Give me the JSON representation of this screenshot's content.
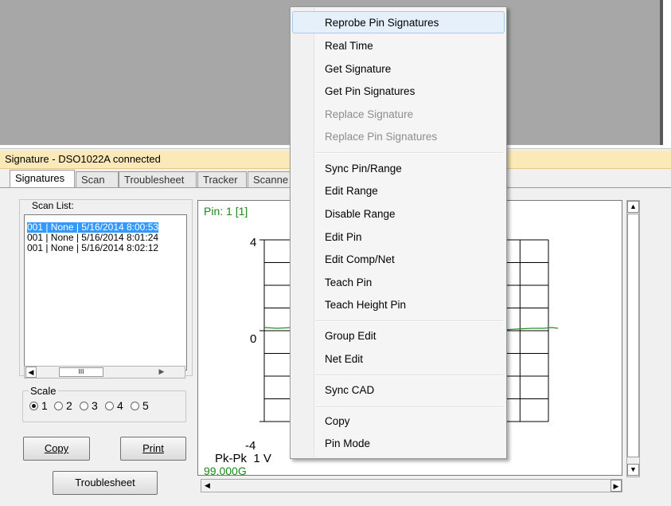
{
  "window": {
    "title": "Signature - DSO1022A connected"
  },
  "tabs": [
    {
      "label": "Signatures",
      "active": true
    },
    {
      "label": "Scan",
      "active": false
    },
    {
      "label": "Troublesheet",
      "active": false
    },
    {
      "label": "Tracker",
      "active": false
    },
    {
      "label": "Scanne",
      "active": false
    }
  ],
  "scan_list": {
    "label": "Scan List:",
    "items": [
      "001 | None | 5/16/2014 8:00:53",
      "001 | None | 5/16/2014 8:01:24",
      "001 | None | 5/16/2014 8:02:12"
    ],
    "selected_index": 0,
    "scroll_thumb_glyph": "III"
  },
  "scale": {
    "label": "Scale",
    "options": [
      "1",
      "2",
      "3",
      "4",
      "5"
    ],
    "selected": "1"
  },
  "buttons": {
    "copy": "Copy",
    "print": "Print",
    "troubleshoot": "Troublesheet"
  },
  "chart": {
    "pin_label": "Pin: 1 [1]",
    "y_max_label": "4",
    "y_mid_label": "0",
    "y_min_label": "-4",
    "pkpk_label": "Pk-Pk  1 V",
    "resistance_label": "99.000G",
    "colors": {
      "pin_label": "#1a8a1a",
      "trace": "#2e8b2e",
      "grid": "#000000"
    }
  },
  "context_menu": {
    "items": [
      {
        "label": "Reprobe Pin Signatures",
        "enabled": true,
        "highlighted": true
      },
      {
        "label": "Real Time",
        "enabled": true
      },
      {
        "label": "Get Signature",
        "enabled": true
      },
      {
        "label": "Get Pin Signatures",
        "enabled": true
      },
      {
        "label": "Replace Signature",
        "enabled": false
      },
      {
        "label": "Replace Pin Signatures",
        "enabled": false
      },
      {
        "label": "Sync Pin/Range",
        "enabled": true
      },
      {
        "label": "Edit Range",
        "enabled": true
      },
      {
        "label": "Disable Range",
        "enabled": true
      },
      {
        "label": "Edit Pin",
        "enabled": true
      },
      {
        "label": "Edit Comp/Net",
        "enabled": true
      },
      {
        "label": "Teach Pin",
        "enabled": true
      },
      {
        "label": "Teach Height Pin",
        "enabled": true
      },
      {
        "label": "Group Edit",
        "enabled": true
      },
      {
        "label": "Net Edit",
        "enabled": true
      },
      {
        "label": "Sync CAD",
        "enabled": true
      },
      {
        "label": "Copy",
        "enabled": true
      },
      {
        "label": "Pin Mode",
        "enabled": true
      }
    ]
  }
}
